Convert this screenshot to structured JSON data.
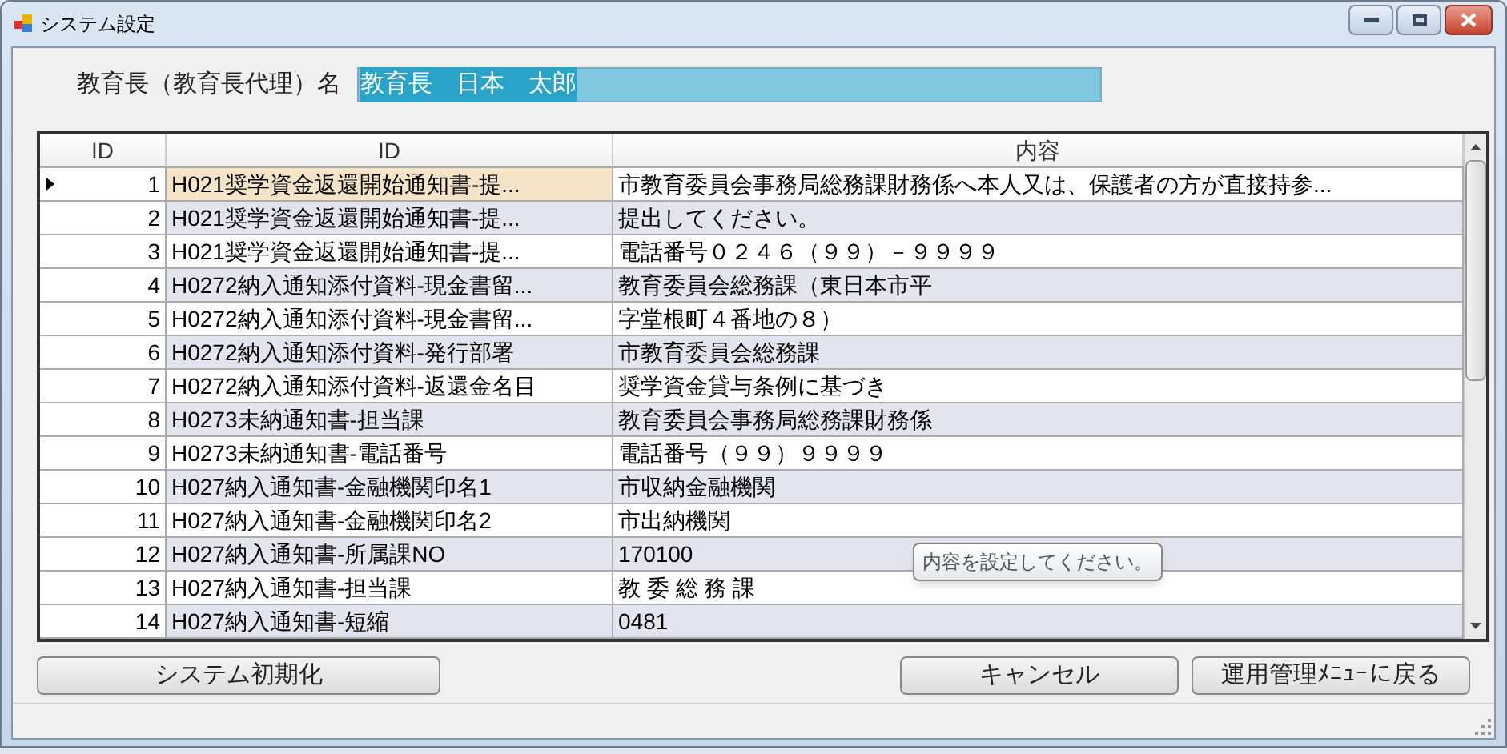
{
  "window": {
    "title": "システム設定"
  },
  "name_field": {
    "label": "教育長（教育長代理）名",
    "value": "教育長　日本　太郎",
    "text_selected": true
  },
  "table": {
    "columns": [
      "ID",
      "ID",
      "内容"
    ],
    "rows": [
      {
        "cells": [
          "1",
          "H021奨学資金返還開始通知書-提...",
          "市教育委員会事務局総務課財務係へ本人又は、保護者の方が直接持参..."
        ],
        "current": true
      },
      {
        "cells": [
          "2",
          "H021奨学資金返還開始通知書-提...",
          "提出してください。"
        ],
        "current": false
      },
      {
        "cells": [
          "3",
          "H021奨学資金返還開始通知書-提...",
          "電話番号０２４６（９９）－９９９９"
        ],
        "current": false
      },
      {
        "cells": [
          "4",
          "H0272納入通知添付資料-現金書留...",
          "教育委員会総務課（東日本市平"
        ],
        "current": false
      },
      {
        "cells": [
          "5",
          "H0272納入通知添付資料-現金書留...",
          "字堂根町４番地の８）"
        ],
        "current": false
      },
      {
        "cells": [
          "6",
          "H0272納入通知添付資料-発行部署",
          "市教育委員会総務課"
        ],
        "current": false
      },
      {
        "cells": [
          "7",
          "H0272納入通知添付資料-返還金名目",
          "奨学資金貸与条例に基づき"
        ],
        "current": false
      },
      {
        "cells": [
          "8",
          "H0273未納通知書-担当課",
          "教育委員会事務局総務課財務係"
        ],
        "current": false
      },
      {
        "cells": [
          "9",
          "H0273未納通知書-電話番号",
          "電話番号（９９）９９９９"
        ],
        "current": false
      },
      {
        "cells": [
          "10",
          "H027納入通知書-金融機関印名1",
          "市収納金融機関"
        ],
        "current": false
      },
      {
        "cells": [
          "11",
          "H027納入通知書-金融機関印名2",
          "市出納機関"
        ],
        "current": false
      },
      {
        "cells": [
          "12",
          "H027納入通知書-所属課NO",
          "170100"
        ],
        "current": false
      },
      {
        "cells": [
          "13",
          "H027納入通知書-担当課",
          "教 委 総 務 課"
        ],
        "current": false
      },
      {
        "cells": [
          "14",
          "H027納入通知書-短縮",
          "0481"
        ],
        "current": false
      }
    ]
  },
  "tooltip": "内容を設定してください。",
  "buttons": [
    {
      "label": "システム初期化",
      "kind": "left"
    },
    {
      "label": "キャンセル",
      "kind": "right"
    },
    {
      "label": "運用管理ﾒﾆｭｰに戻る",
      "kind": "right"
    }
  ]
}
